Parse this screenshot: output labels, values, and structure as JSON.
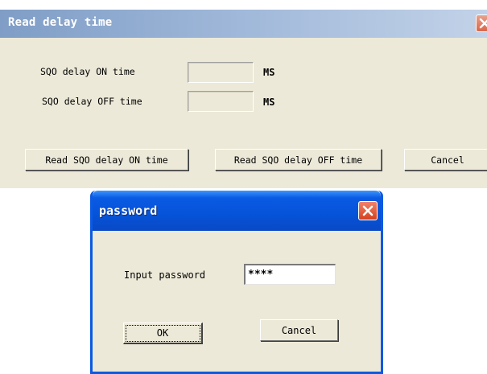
{
  "back_window": {
    "title": "Read delay time",
    "on_label": "SQO delay ON time",
    "off_label": "SQO delay OFF time",
    "on_value": "",
    "off_value": "",
    "unit_on": "MS",
    "unit_off": "MS",
    "read_on_label": "Read SQO delay ON time",
    "read_off_label": "Read SQO delay OFF time",
    "cancel_label": "Cancel"
  },
  "password_dialog": {
    "title": "password",
    "prompt": "Input password",
    "password_value": "****",
    "ok_label": "OK",
    "cancel_label": "Cancel"
  },
  "icons": {
    "close": "close-icon"
  },
  "colors": {
    "window_face": "#ece9d8",
    "inactive_title": "#9db6d8",
    "active_title": "#0553d8",
    "close_button": "#d6401d"
  }
}
